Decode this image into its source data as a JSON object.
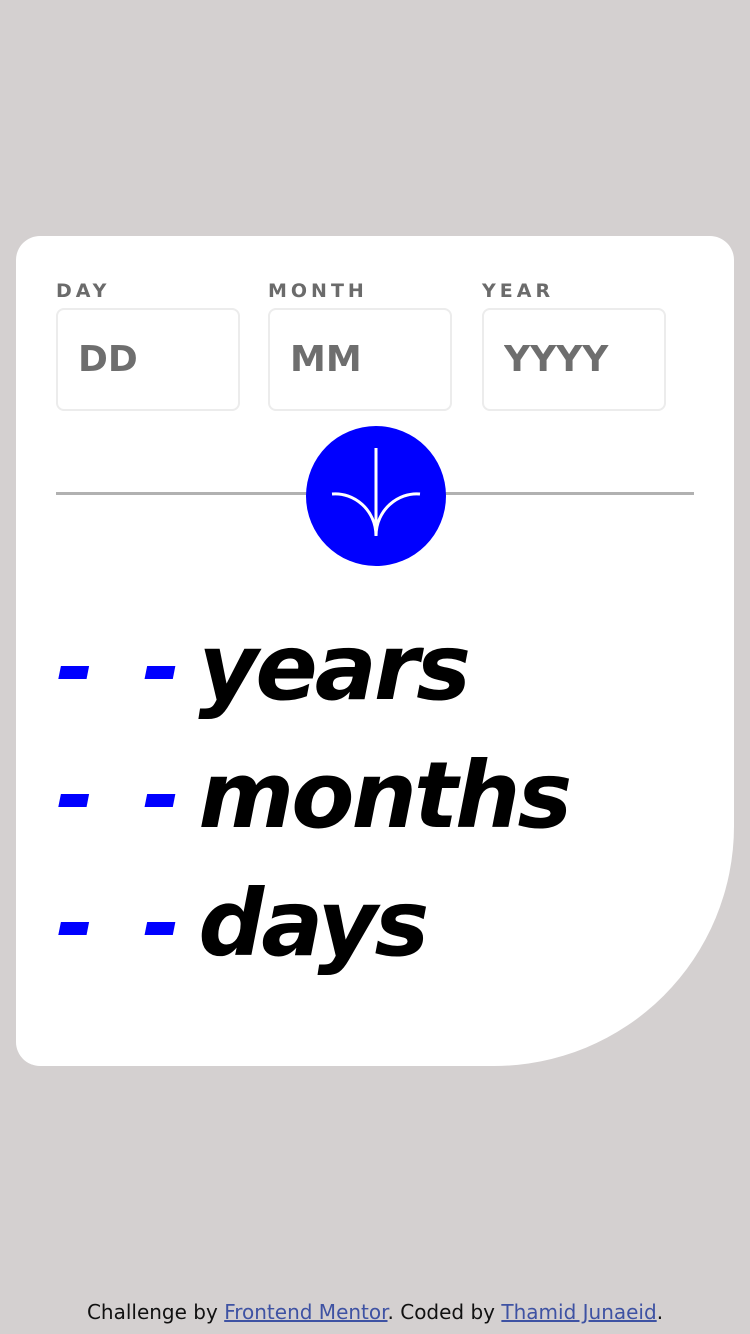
{
  "form": {
    "day": {
      "label": "DAY",
      "placeholder": "DD",
      "value": ""
    },
    "month": {
      "label": "MONTH",
      "placeholder": "MM",
      "value": ""
    },
    "year": {
      "label": "YEAR",
      "placeholder": "YYYY",
      "value": ""
    },
    "submit_icon": "arrow-down-icon"
  },
  "results": {
    "years": {
      "value": "- -",
      "unit": "years"
    },
    "months": {
      "value": "- -",
      "unit": "months"
    },
    "days": {
      "value": "- -",
      "unit": "days"
    }
  },
  "footer": {
    "prefix": "Challenge by",
    "link1": "Frontend Mentor",
    "middle": ". Coded by",
    "link2": "Thamid Junaeid",
    "suffix": "."
  },
  "colors": {
    "background": "#d4d0d0",
    "card": "#ffffff",
    "accent": "#0000ff",
    "label": "#6b6b6b",
    "link": "#3e52a3"
  }
}
